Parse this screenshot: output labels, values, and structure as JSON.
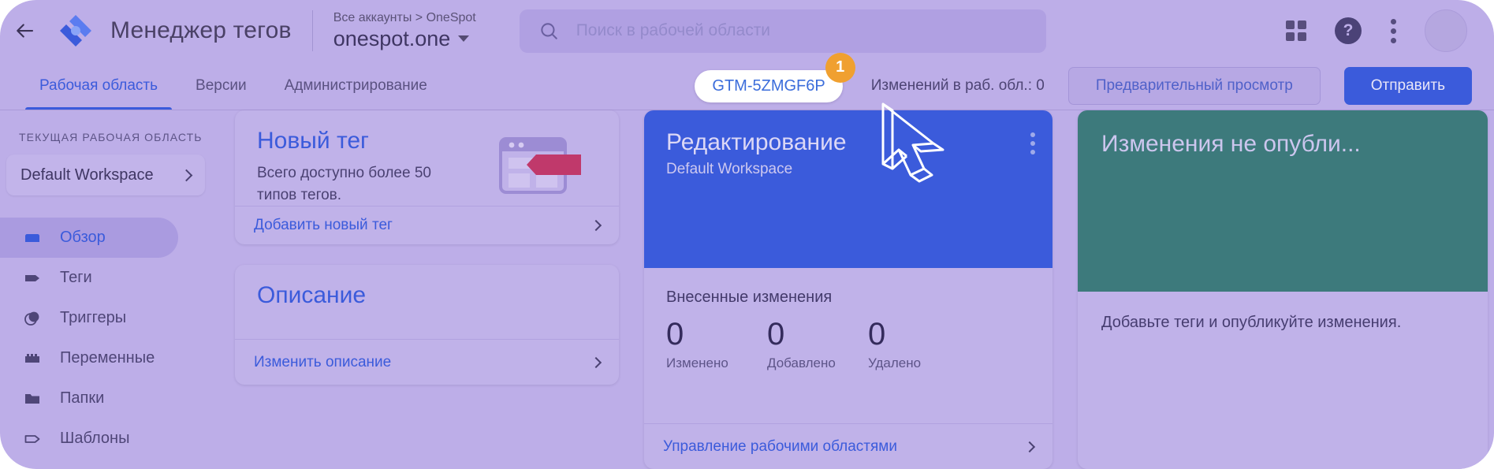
{
  "header": {
    "back_icon": "arrow-left-icon",
    "logo_icon": "gtm-logo-icon",
    "title": "Менеджер тегов",
    "account": {
      "breadcrumb": "Все аккаунты  >  OneSpot",
      "name": "onespot.one",
      "caret_icon": "caret-down-icon"
    },
    "search": {
      "icon": "search-icon",
      "placeholder": "Поиск в рабочей области",
      "value": ""
    },
    "actions": {
      "apps_icon": "apps-grid-icon",
      "help_icon": "help-icon",
      "help_glyph": "?",
      "more_icon": "more-vert-icon",
      "avatar": "avatar"
    }
  },
  "tabbar": {
    "tabs": [
      {
        "label": "Рабочая область",
        "active": true
      },
      {
        "label": "Версии",
        "active": false
      },
      {
        "label": "Администрирование",
        "active": false
      }
    ],
    "container_id": "GTM-5ZMGF6P",
    "step_badge": "1",
    "changes_count": "Изменений в раб. обл.: 0",
    "preview_label": "Предварительный просмотр",
    "submit_label": "Отправить"
  },
  "sidebar": {
    "section_label": "ТЕКУЩАЯ РАБОЧАЯ ОБЛАСТЬ",
    "workspace_name": "Default Workspace",
    "workspace_chevron": "chevron-right-icon",
    "items": [
      {
        "label": "Обзор",
        "icon": "overview-icon",
        "active": true
      },
      {
        "label": "Теги",
        "icon": "tag-icon",
        "active": false
      },
      {
        "label": "Триггеры",
        "icon": "trigger-icon",
        "active": false
      },
      {
        "label": "Переменные",
        "icon": "variable-icon",
        "active": false
      },
      {
        "label": "Папки",
        "icon": "folder-icon",
        "active": false
      },
      {
        "label": "Шаблоны",
        "icon": "template-icon",
        "active": false
      }
    ]
  },
  "cards": {
    "new_tag": {
      "title": "Новый тег",
      "subtitle": "Всего доступно более 50 типов тегов.",
      "illustration": "browser-tag-illustration",
      "footer_label": "Добавить новый тег",
      "footer_chevron": "chevron-right-icon"
    },
    "description": {
      "title": "Описание",
      "footer_label": "Изменить описание",
      "footer_chevron": "chevron-right-icon"
    },
    "edit": {
      "hero_title": "Редактирование",
      "hero_subtitle": "Default Workspace",
      "more_icon": "more-vert-icon",
      "stats_heading": "Внесенные изменения",
      "stats": [
        {
          "value": "0",
          "label": "Изменено"
        },
        {
          "value": "0",
          "label": "Добавлено"
        },
        {
          "value": "0",
          "label": "Удалено"
        }
      ],
      "footer_label": "Управление рабочими областями",
      "footer_chevron": "chevron-right-icon"
    },
    "unpublished": {
      "title": "Изменения не опубли...",
      "body_text": "Добавьте теги и опубликуйте изменения."
    }
  },
  "overlay": {
    "cursor_icon": "mouse-cursor-icon"
  },
  "colors": {
    "tint": "#bdaee8",
    "accent_blue": "#3b5bdb",
    "teal": "#3d7a7c",
    "badge_orange": "#f0a030",
    "tag_pink": "#c0396b"
  }
}
